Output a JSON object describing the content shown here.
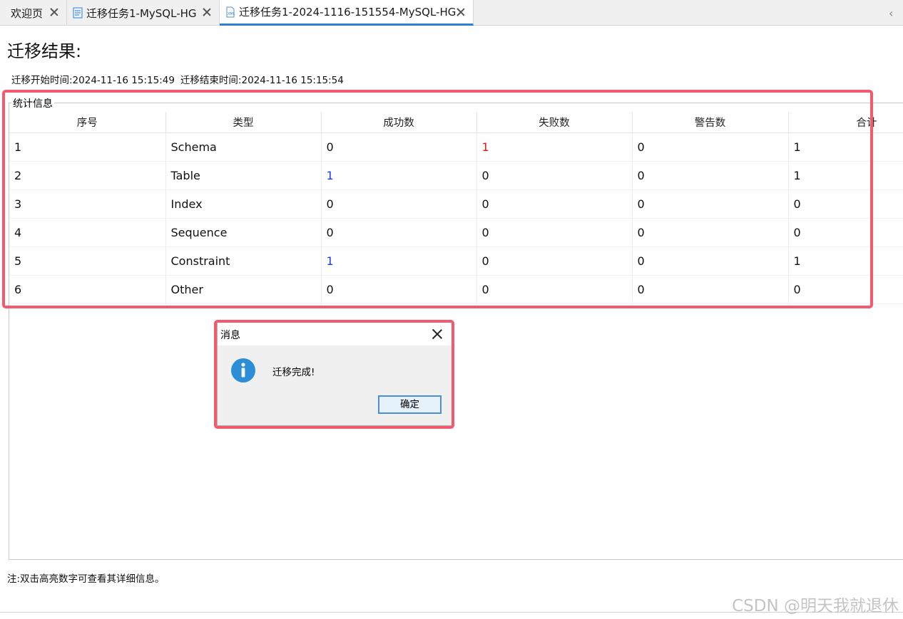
{
  "tabs": [
    {
      "label": "欢迎页"
    },
    {
      "label": "迁移任务1-MySQL-HG"
    },
    {
      "label": "迁移任务1-2024-1116-151554-MySQL-HG"
    }
  ],
  "page": {
    "title": "迁移结果:",
    "start_time": "迁移开始时间:2024-11-16 15:15:49",
    "end_time": "迁移结束时间:2024-11-16 15:15:54"
  },
  "stats": {
    "group_label": "统计信息",
    "columns": [
      "序号",
      "类型",
      "成功数",
      "失败数",
      "警告数",
      "合计"
    ],
    "rows": [
      [
        "1",
        "Schema",
        "0",
        "1",
        "0",
        "1"
      ],
      [
        "2",
        "Table",
        "1",
        "0",
        "0",
        "1"
      ],
      [
        "3",
        "Index",
        "0",
        "0",
        "0",
        "0"
      ],
      [
        "4",
        "Sequence",
        "0",
        "0",
        "0",
        "0"
      ],
      [
        "5",
        "Constraint",
        "1",
        "0",
        "0",
        "1"
      ],
      [
        "6",
        "Other",
        "0",
        "0",
        "0",
        "0"
      ]
    ]
  },
  "dialog": {
    "title": "消息",
    "message": "迁移完成!",
    "ok_label": "确定"
  },
  "note": "注:双击高亮数字可查看其详细信息。",
  "watermark": "CSDN @明天我就退休",
  "colors": {
    "accent": "#2f7fd6",
    "highlight": "#f25a6e",
    "fail": "#e01818",
    "success": "#1a3ee8"
  }
}
